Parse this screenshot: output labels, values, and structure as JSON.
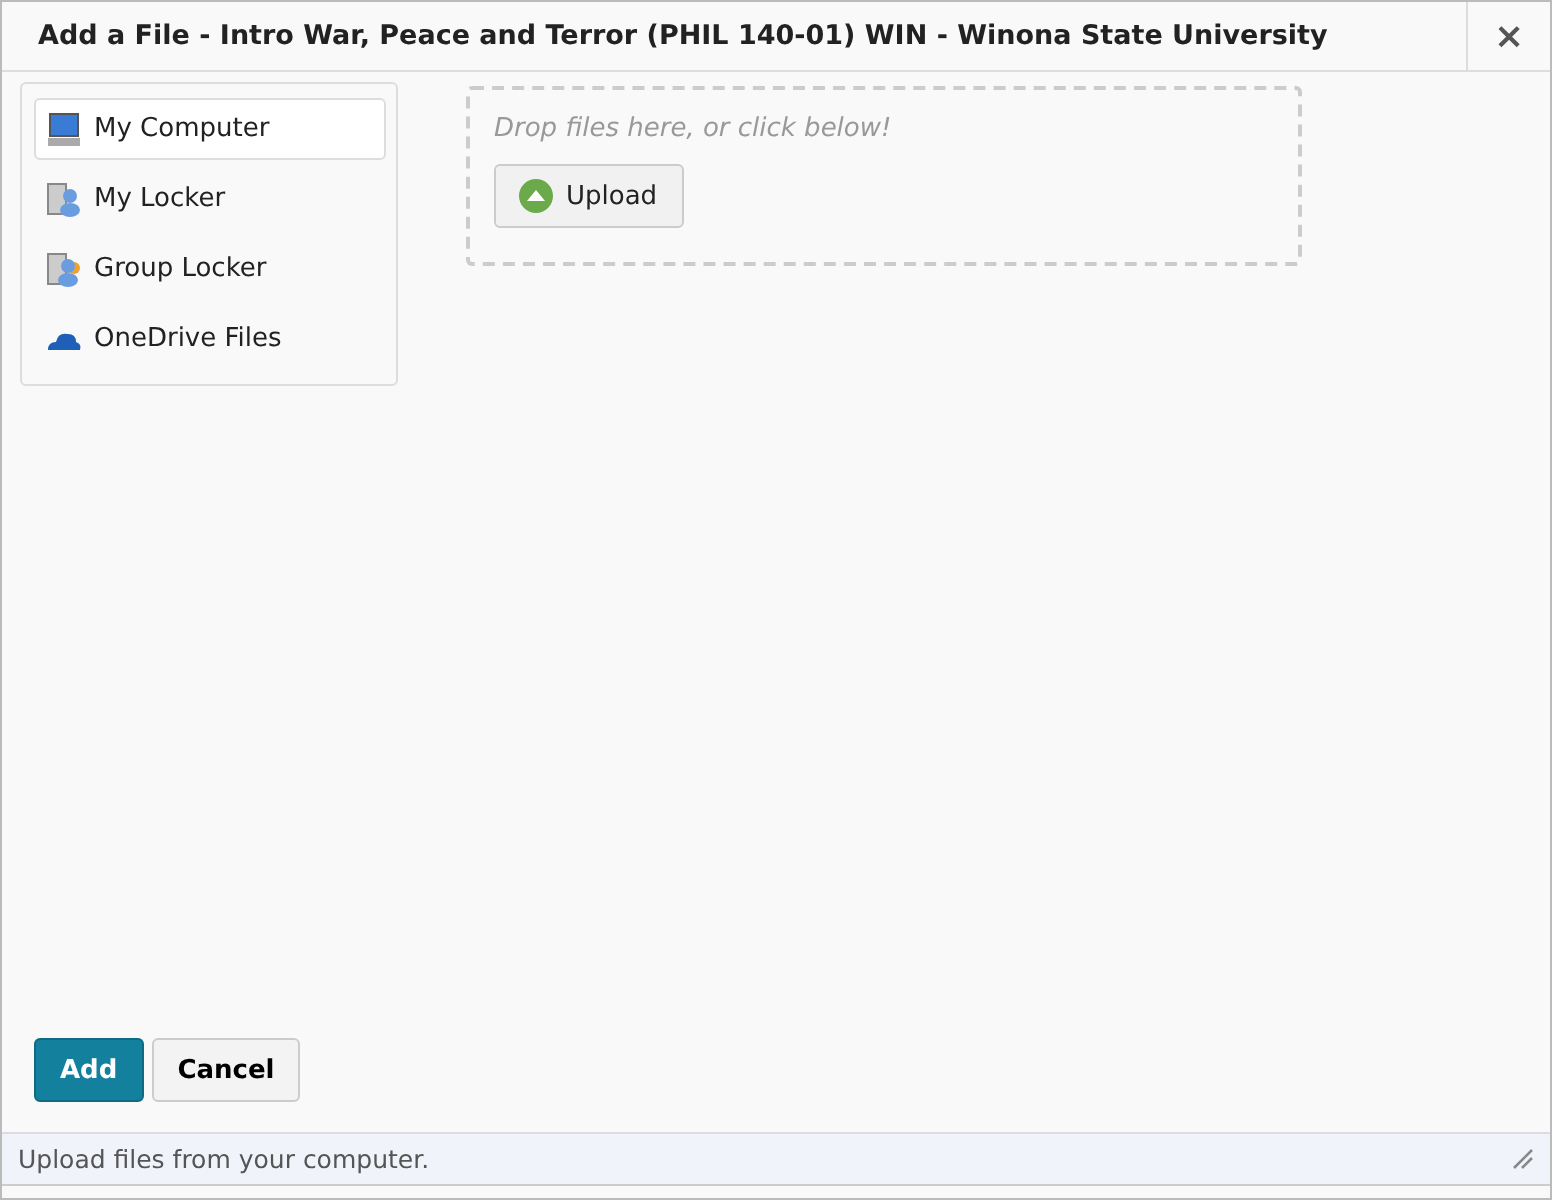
{
  "window": {
    "title": "Add a File - Intro War, Peace and Terror (PHIL 140-01) WIN - Winona State University",
    "close": "×"
  },
  "sources": [
    {
      "label": "My Computer",
      "kind": "computer",
      "selected": true
    },
    {
      "label": "My Locker",
      "kind": "locker",
      "selected": false
    },
    {
      "label": "Group Locker",
      "kind": "group",
      "selected": false
    },
    {
      "label": "OneDrive Files",
      "kind": "cloud",
      "selected": false
    }
  ],
  "dropzone": {
    "hint": "Drop files here, or click below!",
    "button": "Upload"
  },
  "buttons": [
    {
      "label": "Add",
      "kind": "primary"
    },
    {
      "label": "Cancel",
      "kind": "secondary"
    }
  ],
  "status_bar": "Upload files from your computer."
}
